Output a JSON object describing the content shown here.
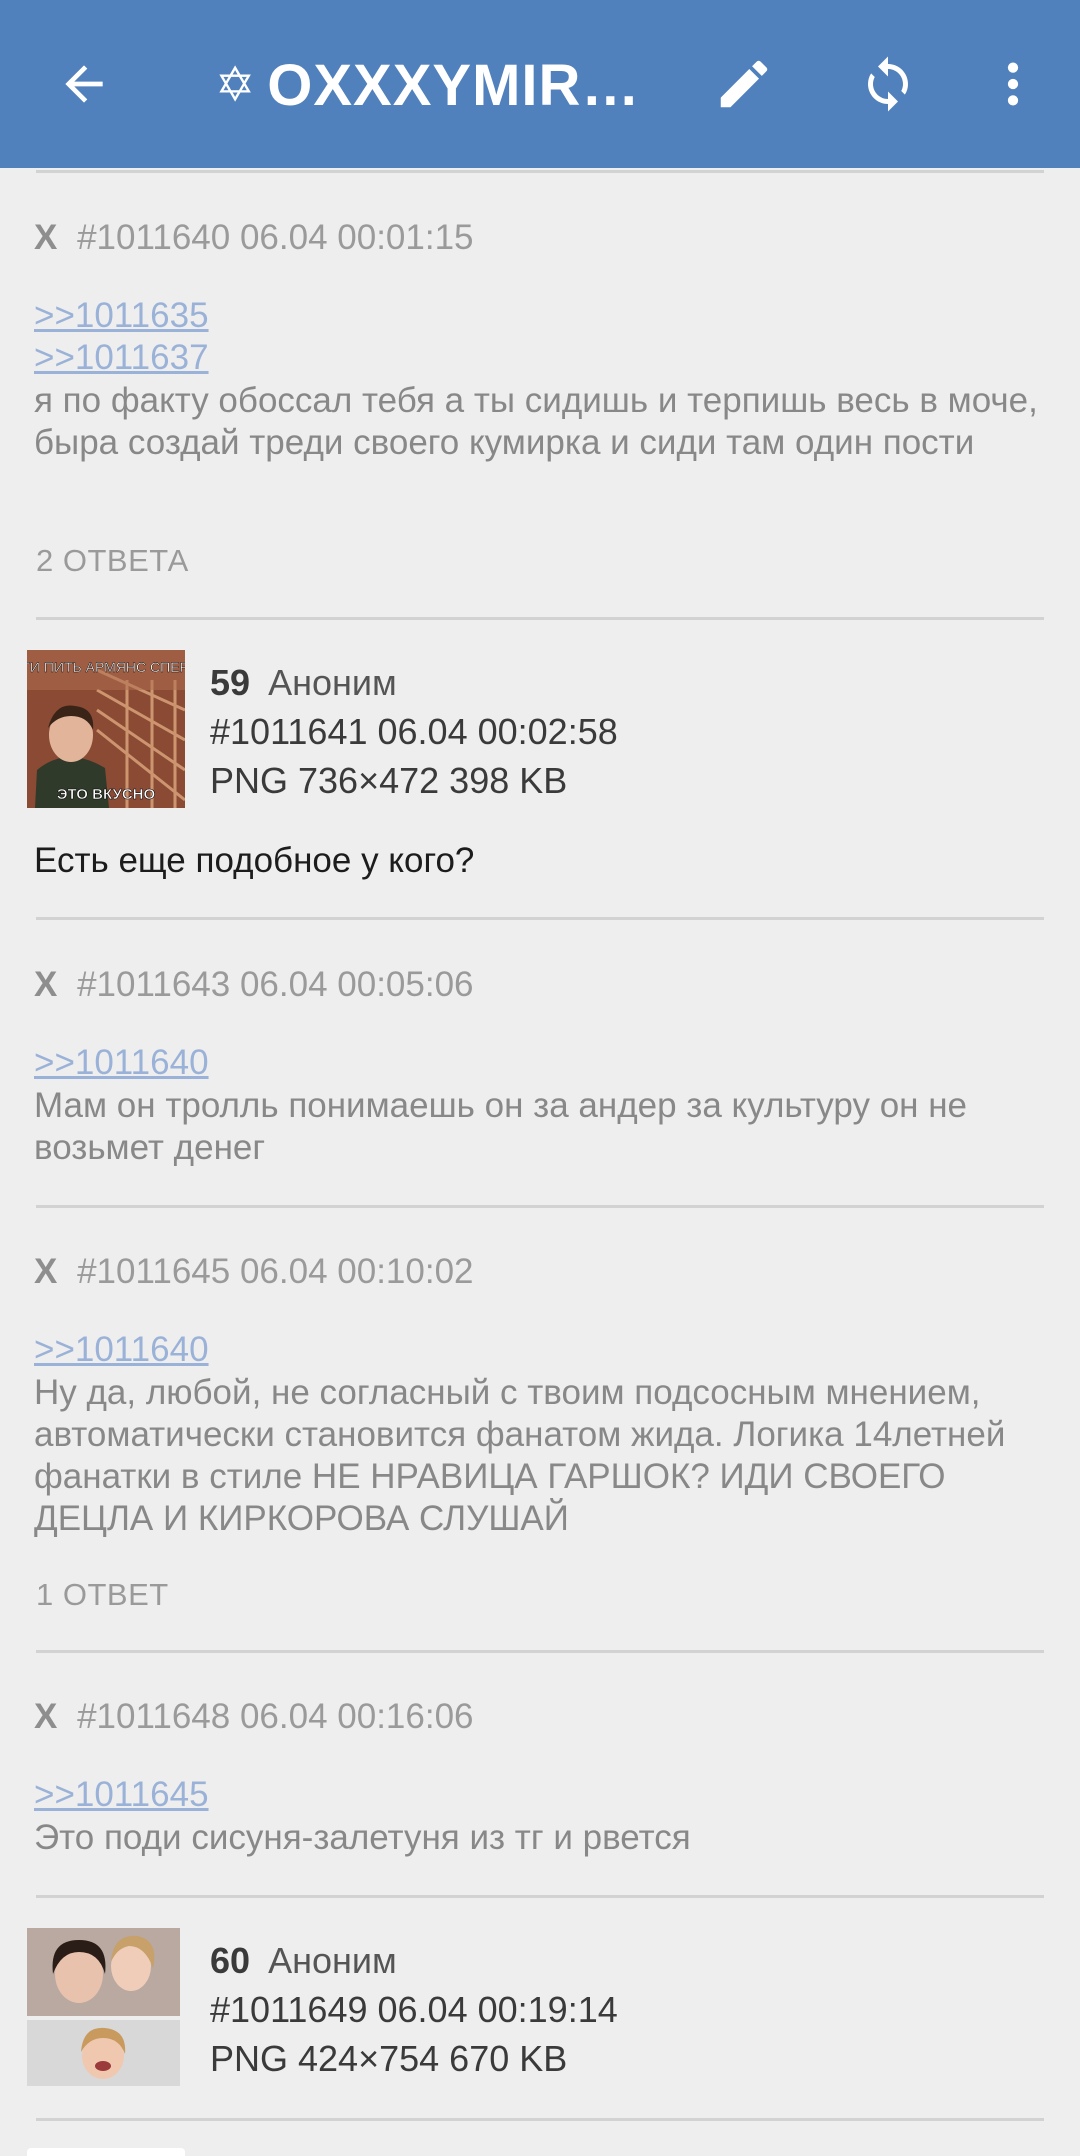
{
  "appbar": {
    "title": "OXXXYMIRO...",
    "title_icon": "star-of-david-icon",
    "icons": [
      "back-arrow-icon",
      "pencil-icon",
      "refresh-icon",
      "more-vert-icon"
    ],
    "color": "#5081bd"
  },
  "posts": [
    {
      "marker": "X",
      "id": "#1011640",
      "time": "06.04 00:01:15",
      "refs": [
        ">>1011635",
        ">>1011637"
      ],
      "text": "я по факту обоссал тебя а ты сидишь и терпишь весь в моче, быра создай треди своего кумирка и сиди там один пости",
      "answers": "2 ОТВЕТА"
    },
    {
      "number": "59",
      "name": "Аноним",
      "id": "#1011641",
      "time": "06.04 00:02:58",
      "file": "PNG 736×472 398 KB",
      "thumb_top": "РЕТИ ПИТЬ АРМЯНС СПЕРМУ",
      "thumb_bottom": "ЭТО ВКУСНО",
      "text": "Есть еще подобное у кого?"
    },
    {
      "marker": "X",
      "id": "#1011643",
      "time": "06.04 00:05:06",
      "refs": [
        ">>1011640"
      ],
      "text": "Мам он тролль понимаешь он за андер за культуру он не возьмет денег"
    },
    {
      "marker": "X",
      "id": "#1011645",
      "time": "06.04 00:10:02",
      "refs": [
        ">>1011640"
      ],
      "text": "Ну да, любой, не согласный с твоим подсосным мнением, автоматически становится фанатом жида. Логика 14летней фанатки в стиле НЕ НРАВИЦА ГАРШОК? ИДИ СВОЕГО ДЕЦЛА И КИРКОРОВА СЛУШАЙ",
      "answers": "1 ОТВЕТ"
    },
    {
      "marker": "X",
      "id": "#1011648",
      "time": "06.04 00:16:06",
      "refs": [
        ">>1011645"
      ],
      "text": "Это поди сисуня-залетуня из тг и рвется"
    },
    {
      "number": "60",
      "name": "Аноним",
      "id": "#1011649",
      "time": "06.04 00:19:14",
      "file": "PNG 424×754 670 KB"
    }
  ]
}
